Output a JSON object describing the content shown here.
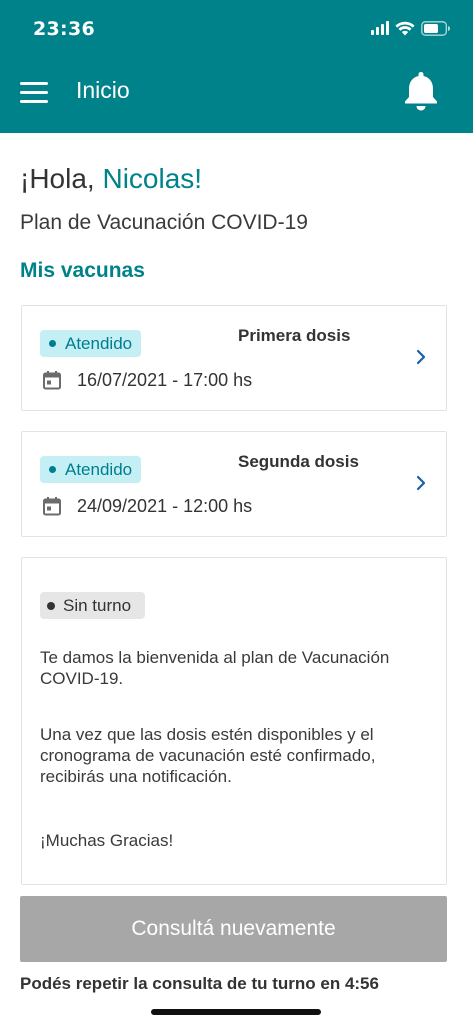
{
  "status_bar": {
    "time": "23:36",
    "icons": [
      "signal-icon",
      "wifi-icon",
      "battery-icon"
    ]
  },
  "appbar": {
    "title": "Inicio",
    "menu_icon": "hamburger-menu-icon",
    "notifications_icon": "bell-icon"
  },
  "greeting": {
    "prefix": "¡Hola, ",
    "name": "Nicolas",
    "suffix": "!"
  },
  "subtitle": "Plan de Vacunación COVID-19",
  "section_title": "Mis vacunas",
  "doses": [
    {
      "status": "Atendido",
      "title": "Primera dosis",
      "date": "16/07/2021 - 17:00 hs"
    },
    {
      "status": "Atendido",
      "title": "Segunda dosis",
      "date": "24/09/2021 - 12:00 hs"
    }
  ],
  "info_card": {
    "status": "Sin turno",
    "paragraphs": [
      "Te damos la bienvenida al plan de Vacunación COVID-19.",
      "Una vez que las dosis estén disponibles y el cronograma de vacunación esté confirmado, recibirás una notificación.",
      "¡Muchas Gracias!"
    ]
  },
  "retry_button": "Consultá nuevamente",
  "retry_note": "Podés repetir la consulta de tu turno en 4:56",
  "colors": {
    "brand": "#00828a",
    "badge_bg": "#c4eff5",
    "badge_text": "#007d8f",
    "neutral_badge_bg": "#e6e6e6",
    "disabled_button": "#a7a7a7"
  }
}
